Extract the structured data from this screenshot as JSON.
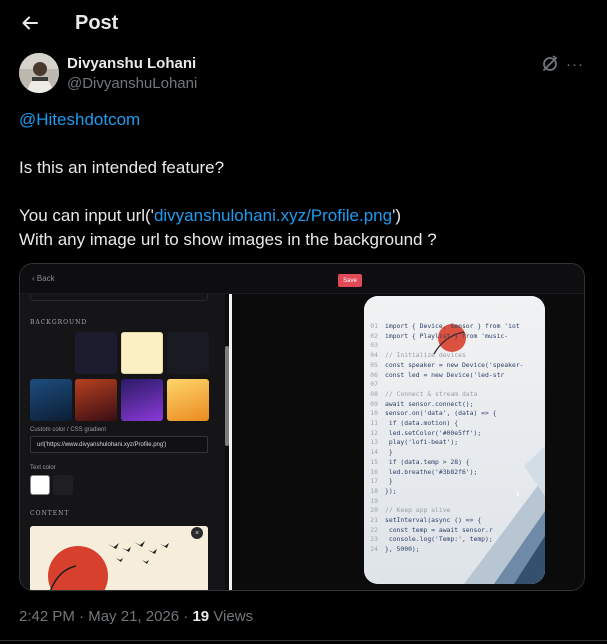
{
  "header": {
    "title": "Post",
    "back_icon": "arrow-left-icon"
  },
  "author": {
    "name": "Divyanshu Lohani",
    "handle": "@DivyanshuLohani",
    "avatar_icon": "avatar",
    "grok_icon": "grok-icon",
    "more_label": "···"
  },
  "tweet": {
    "mention": "@Hiteshdotcom",
    "line1": "Is this an intended feature?",
    "line2_prefix": "You can input url('",
    "line2_link": "divyanshulohani.xyz/Profile.png",
    "line2_suffix": "')",
    "line3": "With any image url to show images in the background ?"
  },
  "media": {
    "top_bar": {
      "back_label": "‹ Back",
      "save_label": "Save"
    },
    "panel": {
      "background_heading": "BACKGROUND",
      "custom_label": "Custom color / CSS gradient",
      "url_value": "url('https://www.divyanshulohani.xyz/Profile.png')",
      "text_color_label": "Text color",
      "content_heading": "CONTENT",
      "close_label": "×",
      "swatch_colors_row1": [
        "#1c1c2e",
        "#fbefc4",
        "#1a1a22"
      ],
      "swatch_colors_row2": [
        "#1d4e80",
        "#8a2a1f",
        "#6b2bb8",
        "#f2a33a"
      ],
      "text_colors": [
        "#ffffff",
        "#1f1f22"
      ]
    },
    "code": [
      {
        "n": "01",
        "t": "import { Device, Sensor } from 'iot"
      },
      {
        "n": "02",
        "t": "import { Playlist } from 'music-"
      },
      {
        "n": "03",
        "t": ""
      },
      {
        "n": "04",
        "t": "// Initialize devices"
      },
      {
        "n": "05",
        "t": "const speaker = new Device('speaker-"
      },
      {
        "n": "06",
        "t": "const led     = new Device('led-str"
      },
      {
        "n": "07",
        "t": ""
      },
      {
        "n": "08",
        "t": "// Connect & stream data"
      },
      {
        "n": "09",
        "t": "await sensor.connect();"
      },
      {
        "n": "10",
        "t": "sensor.on('data', (data) => {"
      },
      {
        "n": "11",
        "t": "  if (data.motion) {"
      },
      {
        "n": "12",
        "t": "    led.setColor('#00e5ff');"
      },
      {
        "n": "13",
        "t": "    play('lofi-beat');"
      },
      {
        "n": "14",
        "t": "  }"
      },
      {
        "n": "15",
        "t": "  if (data.temp > 28) {"
      },
      {
        "n": "16",
        "t": "    led.breathe('#3b82f6');"
      },
      {
        "n": "17",
        "t": "  }"
      },
      {
        "n": "18",
        "t": "});"
      },
      {
        "n": "19",
        "t": ""
      },
      {
        "n": "20",
        "t": "// Keep app alive"
      },
      {
        "n": "21",
        "t": "setInterval(async () => {"
      },
      {
        "n": "22",
        "t": "  const temp = await sensor.r"
      },
      {
        "n": "23",
        "t": "  console.log('Temp:', temp);"
      },
      {
        "n": "24",
        "t": "}, 5000);"
      }
    ],
    "chevron": "›"
  },
  "meta": {
    "time": "2:42 PM",
    "sep": " · ",
    "date": "May 21, 2026",
    "sep2": " · ",
    "views_count": "19",
    "views_label": " Views"
  }
}
